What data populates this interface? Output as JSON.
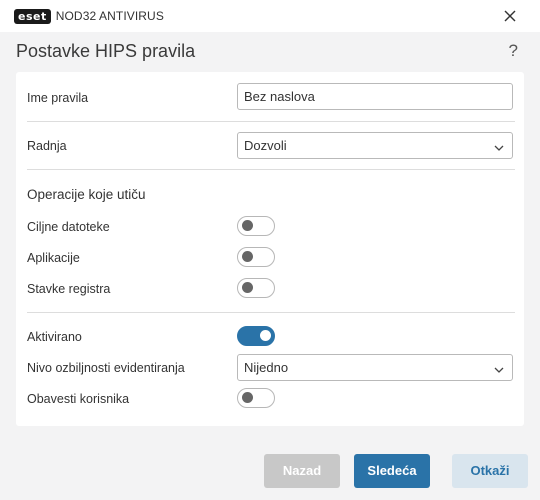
{
  "app": {
    "logo_badge": "eset",
    "product_name": "NOD32 ANTIVIRUS"
  },
  "header": {
    "title": "Postavke HIPS pravila",
    "help_glyph": "?"
  },
  "form": {
    "rule_name": {
      "label": "Ime pravila",
      "value": "Bez naslova"
    },
    "action": {
      "label": "Radnja",
      "value": "Dozvoli"
    },
    "operations_title": "Operacije koje utiču",
    "target_files": {
      "label": "Ciljne datoteke",
      "enabled": false
    },
    "applications": {
      "label": "Aplikacije",
      "enabled": false
    },
    "registry_entries": {
      "label": "Stavke registra",
      "enabled": false
    },
    "activated": {
      "label": "Aktivirano",
      "enabled": true
    },
    "log_severity": {
      "label": "Nivo ozbiljnosti evidentiranja",
      "value": "Nijedno"
    },
    "notify_user": {
      "label": "Obavesti korisnika",
      "enabled": false
    }
  },
  "footer": {
    "back_label": "Nazad",
    "next_label": "Sledeća",
    "cancel_label": "Otkaži"
  },
  "colors": {
    "accent": "#2a73a8",
    "background": "#f3f3f4",
    "disabled_button": "#c8c8c8"
  }
}
